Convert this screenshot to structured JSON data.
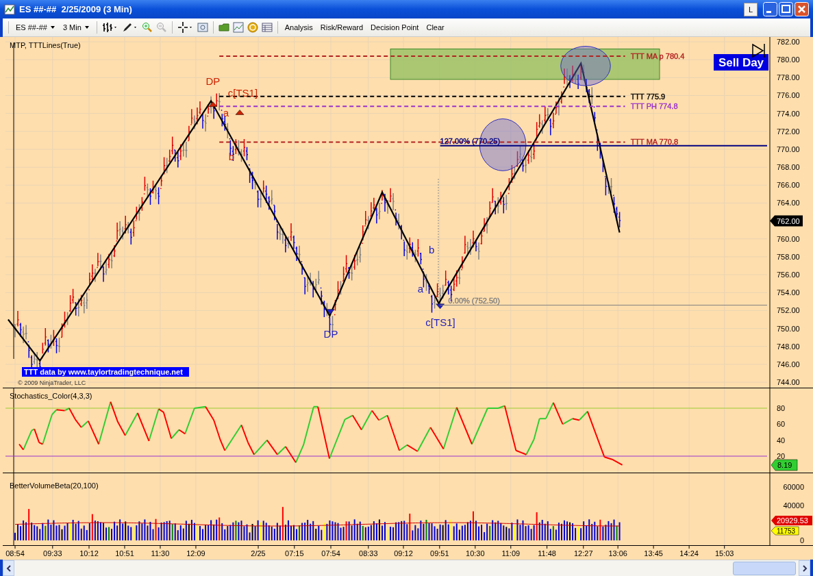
{
  "window": {
    "title": "ES ##-##  2/25/2009 (3 Min)",
    "link_button": "L"
  },
  "toolbar": {
    "instrument": "ES ##-##",
    "interval": "3 Min",
    "menu": [
      "Analysis",
      "Risk/Reward",
      "Decision Point",
      "Clear"
    ]
  },
  "price_panel": {
    "label": "MTP, TTTLines(True)",
    "signal": "Sell Day",
    "credit": "TTT data by www.taylortradingtechnique.net",
    "copyright": "© 2009 NinjaTrader, LLC",
    "last_price": "762.00",
    "price_axis": [
      "782.00",
      "780.00",
      "778.00",
      "776.00",
      "774.00",
      "772.00",
      "770.00",
      "768.00",
      "766.00",
      "764.00",
      "760.00",
      "758.00",
      "756.00",
      "754.00",
      "752.00",
      "750.00",
      "748.00",
      "746.00",
      "744.00"
    ],
    "levels": [
      {
        "label": "TTT MA p 780.4",
        "color": "#b22222"
      },
      {
        "label": "TTT  775.9",
        "color": "#000000"
      },
      {
        "label": "TTT PH 774.8",
        "color": "#9932cc"
      },
      {
        "label": "TTT MA 770.8",
        "color": "#b22222"
      }
    ],
    "fib_lines": [
      {
        "label": "127.00% (770.25)",
        "color": "#000080"
      },
      {
        "label": "0.00% (752.50)",
        "color": "#808080"
      }
    ],
    "pattern_labels": [
      {
        "label": "DP",
        "color": "#cc2200"
      },
      {
        "label": "a",
        "color": "#cc2200"
      },
      {
        "label": "c[TS1]",
        "color": "#cc2200"
      },
      {
        "label": "b",
        "color": "#cc2200"
      },
      {
        "label": "DP",
        "color": "#2020c0"
      },
      {
        "label": "a",
        "color": "#2020c0"
      },
      {
        "label": "b",
        "color": "#2020c0"
      },
      {
        "label": "c[TS1]",
        "color": "#2020c0"
      }
    ]
  },
  "stochastic_panel": {
    "label": "Stochastics_Color(4,3,3)",
    "reading": "8.19",
    "axis": [
      "80",
      "60",
      "40",
      "20"
    ]
  },
  "volume_panel": {
    "label": "BetterVolumeBeta(20,100)",
    "axis": [
      "60000",
      "40000",
      "0"
    ],
    "average_reading": "20929.53",
    "last_reading": "11753"
  },
  "time_axis": [
    "08:54",
    "09:33",
    "10:12",
    "10:51",
    "11:30",
    "12:09",
    "2/25",
    "07:15",
    "07:54",
    "08:33",
    "09:12",
    "09:51",
    "10:30",
    "11:09",
    "11:48",
    "12:27",
    "13:06",
    "13:45",
    "14:24",
    "15:03"
  ]
}
